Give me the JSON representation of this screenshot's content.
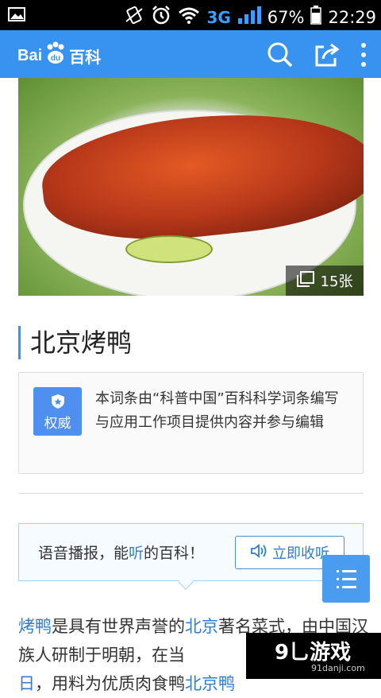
{
  "status_bar": {
    "network": "3G",
    "battery_percent": "67%",
    "time": "22:29"
  },
  "app_bar": {
    "logo_left": "Bai",
    "logo_paw": "du",
    "logo_right": "百科"
  },
  "hero": {
    "photo_count": "15张"
  },
  "article": {
    "title": "北京烤鸭",
    "authority_badge": "权威",
    "authority_desc": "本词条由“科普中国”百科科学词条编写与应用工作项目提供内容并参与编辑"
  },
  "voice": {
    "prefix": "语音播报，能",
    "highlight": "听",
    "suffix": "的百科！",
    "button_label": "立即收听"
  },
  "intro": {
    "link1": "烤鸭",
    "text1": "是具有世界声誉的",
    "link2": "北京",
    "text2": "著名菜式，由中国汉族人研制于明朝，在当",
    "line3_link": "日",
    "line3_text": "，用料为优质肉食鸭",
    "line3_link2": "北京鸭"
  },
  "watermark": {
    "brand": "9乚游戏",
    "site": "91danji.com"
  },
  "colors": {
    "accent": "#3893f0",
    "link": "#2d7dd6",
    "badge": "#4e8ff0"
  },
  "icons": [
    "search-icon",
    "share-icon",
    "more-icon",
    "gallery-icon",
    "shield-icon",
    "speaker-icon",
    "toc-icon"
  ]
}
